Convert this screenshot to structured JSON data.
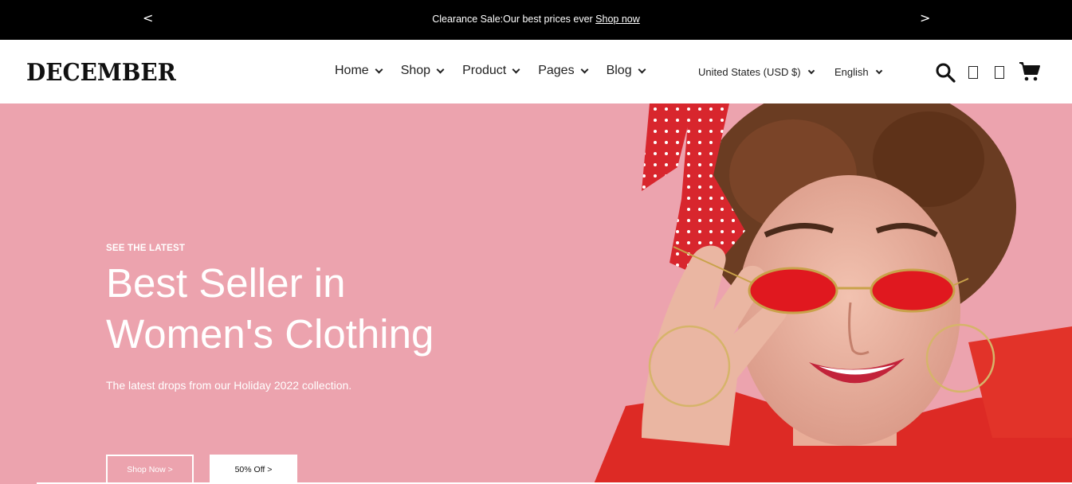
{
  "announcement": {
    "prev": "<",
    "next": ">",
    "message": "Clearance Sale:Our best prices ever",
    "link": "Shop now"
  },
  "header": {
    "logo": "DECEMBER",
    "nav": [
      "Home",
      "Shop",
      "Product",
      "Pages",
      "Blog"
    ],
    "country": "United States (USD $)",
    "language": "English"
  },
  "hero": {
    "eyebrow": "SEE THE LATEST",
    "title_line1": "Best Seller in",
    "title_line2": "Women's Clothing",
    "subtitle": "The latest drops from our Holiday 2022 collection.",
    "primary_button": "Shop Now >",
    "secondary_button": "50% Off >"
  },
  "colors": {
    "hero_background": "#eca3ae",
    "accent_red": "#e0202a",
    "announcement_bg": "#000000"
  },
  "icons": [
    "search-icon",
    "wishlist-icon",
    "compare-icon",
    "cart-icon",
    "chevron-down-icon"
  ]
}
